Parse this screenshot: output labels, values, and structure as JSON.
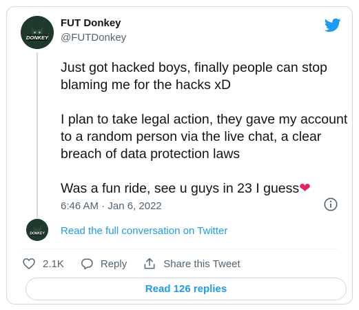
{
  "author": {
    "display_name": "FUT Donkey",
    "handle": "@FUTDonkey",
    "avatar_text": "DONKEY"
  },
  "tweet": {
    "paragraphs": [
      "Just got hacked boys, finally people can stop blaming me for the hacks xD",
      "I plan to take legal action, they gave my account to a random person via the live chat, a clear breach of data protection laws",
      "Was a fun ride, see u guys in 23 I guess"
    ],
    "emoji": "❤",
    "timestamp": "6:46 AM · Jan 6, 2022"
  },
  "conversation_link": "Read the full conversation on Twitter",
  "actions": {
    "like_count": "2.1K",
    "reply_label": "Reply",
    "share_label": "Share this Tweet"
  },
  "read_replies_label": "Read 126 replies",
  "colors": {
    "twitter_blue": "#1d9bf0",
    "text_secondary": "#536471",
    "heart": "#e0245e",
    "avatar_bg": "#1f3a2c"
  }
}
